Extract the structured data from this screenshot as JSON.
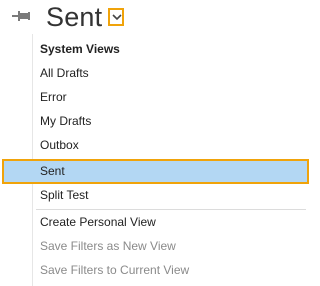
{
  "header": {
    "title": "Sent",
    "icons": {
      "pin": "pin-icon",
      "dropdown": "chevron-down-icon"
    },
    "accent_color": "#f0a30a"
  },
  "menu": {
    "section_label": "System Views",
    "views": [
      "All Drafts",
      "Error",
      "My Drafts",
      "Outbox",
      "Sent",
      "Split Test"
    ],
    "selected": "Sent",
    "selected_bg": "#b3d7f3",
    "actions": [
      {
        "label": "Create Personal View",
        "enabled": true
      },
      {
        "label": "Save Filters as New View",
        "enabled": false
      },
      {
        "label": "Save Filters to Current View",
        "enabled": false
      }
    ]
  }
}
